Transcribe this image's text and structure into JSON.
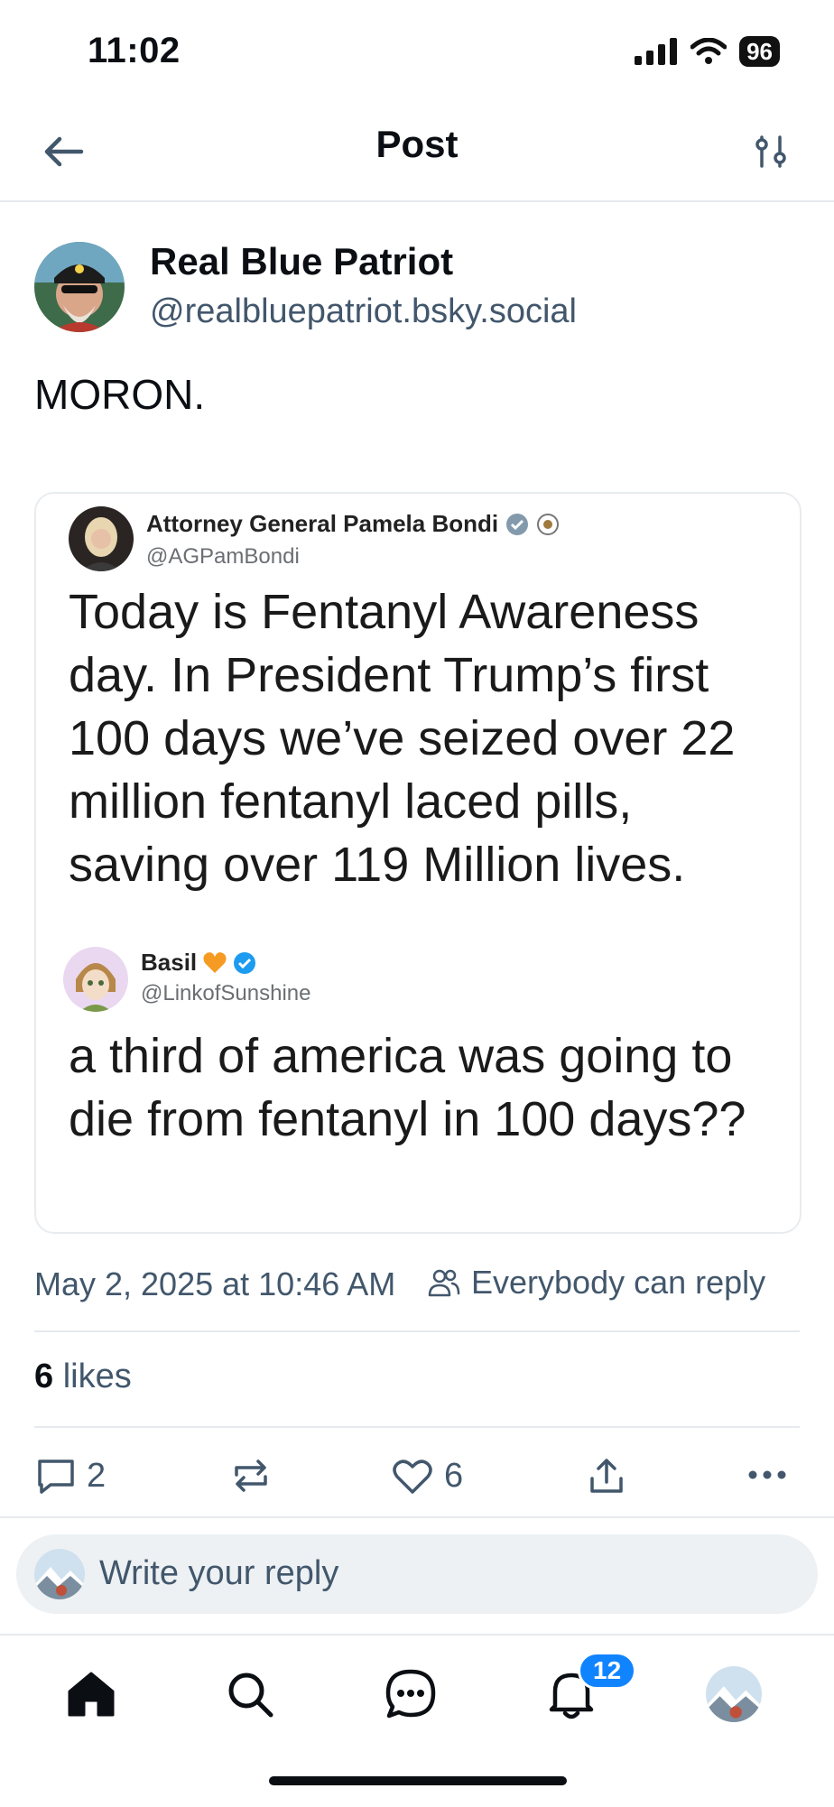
{
  "status_bar": {
    "time": "11:02",
    "battery": "96",
    "signal_icon": "signal-bars-icon",
    "wifi_icon": "wifi-icon"
  },
  "header": {
    "title": "Post",
    "back_icon": "arrow-left-icon",
    "settings_icon": "sliders-icon"
  },
  "post": {
    "author_name": "Real Blue Patriot",
    "author_handle": "@realbluepatriot.bsky.social",
    "text": "MORON.",
    "quoted_image": {
      "tweet1": {
        "name": "Attorney General Pamela Bondi",
        "handle": "@AGPamBondi",
        "text": "Today is Fentanyl Awareness day. In President Trump’s first 100 days we’ve seized over 22 million fentanyl laced pills, saving over 119 Million lives."
      },
      "tweet2": {
        "name": "Basil",
        "handle": "@LinkofSunshine",
        "text": "a third of america was going to die from fentanyl in 100 days??"
      }
    },
    "timestamp": "May 2, 2025 at 10:46 AM",
    "reply_setting": "Everybody can reply",
    "likes_count": "6",
    "likes_label": "likes",
    "actions": {
      "reply_count": "2",
      "like_count": "6"
    }
  },
  "reply_bar": {
    "placeholder": "Write your reply"
  },
  "tab_bar": {
    "notifications_badge": "12"
  },
  "colors": {
    "accent": "#1083fe",
    "muted_text": "#42576c",
    "border": "#e6e9ed"
  }
}
